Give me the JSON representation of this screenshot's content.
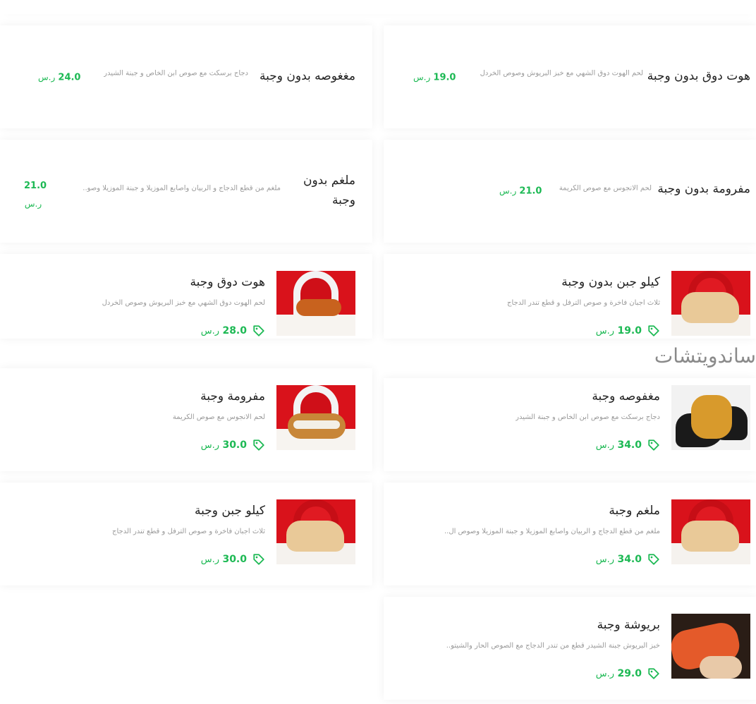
{
  "currency": "ر.س",
  "section_sandwiches": "ساندويتشات",
  "no_meal": [
    {
      "title": "هوت دوق بدون وجبة",
      "desc": "لحم الهوت دوق الشهي مع خبز البريوش وصوص الخردل",
      "price": "19.0"
    },
    {
      "title": "مغغوصه بدون وجبة",
      "desc": "دجاج برسكت مع صوص ابن الخاص و جبنة الشيدر",
      "price": "24.0"
    },
    {
      "title": "مفرومة بدون وجبة",
      "desc": "لحم الانجوس مع صوص الكريمة",
      "price": "21.0"
    },
    {
      "title": "ملغم بدون وجبة",
      "desc": "ملغم من قطع الدجاج و الربيان واصابع الموزيلا و جبنة الموزيلا وصو..",
      "price": "21.0"
    }
  ],
  "meals": [
    {
      "title": "كيلو جبن بدون وجبة",
      "desc": "ثلاث اجبان فاخرة و صوص الترفل و قطع تندر الدجاج",
      "price": "19.0"
    },
    {
      "title": "هوت دوق وجبة",
      "desc": "لحم الهوت دوق الشهي مع خبز البريوش وصوص الخردل",
      "price": "28.0"
    },
    {
      "title": "مغفوصه وجبة",
      "desc": "دجاج برسكت مع صوص ابن الخاص و جبنة الشيدر",
      "price": "34.0"
    },
    {
      "title": "مفرومة وجبة",
      "desc": "لحم الانجوس مع صوص الكريمة",
      "price": "30.0"
    },
    {
      "title": "ملغم وجبة",
      "desc": "ملغم من قطع الدجاج و الربيان واصابع الموزيلا و جبنة الموزيلا وصوص ال..",
      "price": "34.0"
    },
    {
      "title": "كيلو جبن وجبة",
      "desc": "ثلاث اجبان فاخرة و صوص الترفل و قطع تندر الدجاج",
      "price": "30.0"
    },
    {
      "title": "بريوشة وجبة",
      "desc": "خبز البريوش جبنة الشيدر قطع من تندر الدجاج مع الصوص الحار والشيتو..",
      "price": "29.0"
    }
  ],
  "colors": {
    "price": "#1db954",
    "tile_red": "#d9121b"
  },
  "icons": {
    "price_tag": "tag-icon"
  }
}
